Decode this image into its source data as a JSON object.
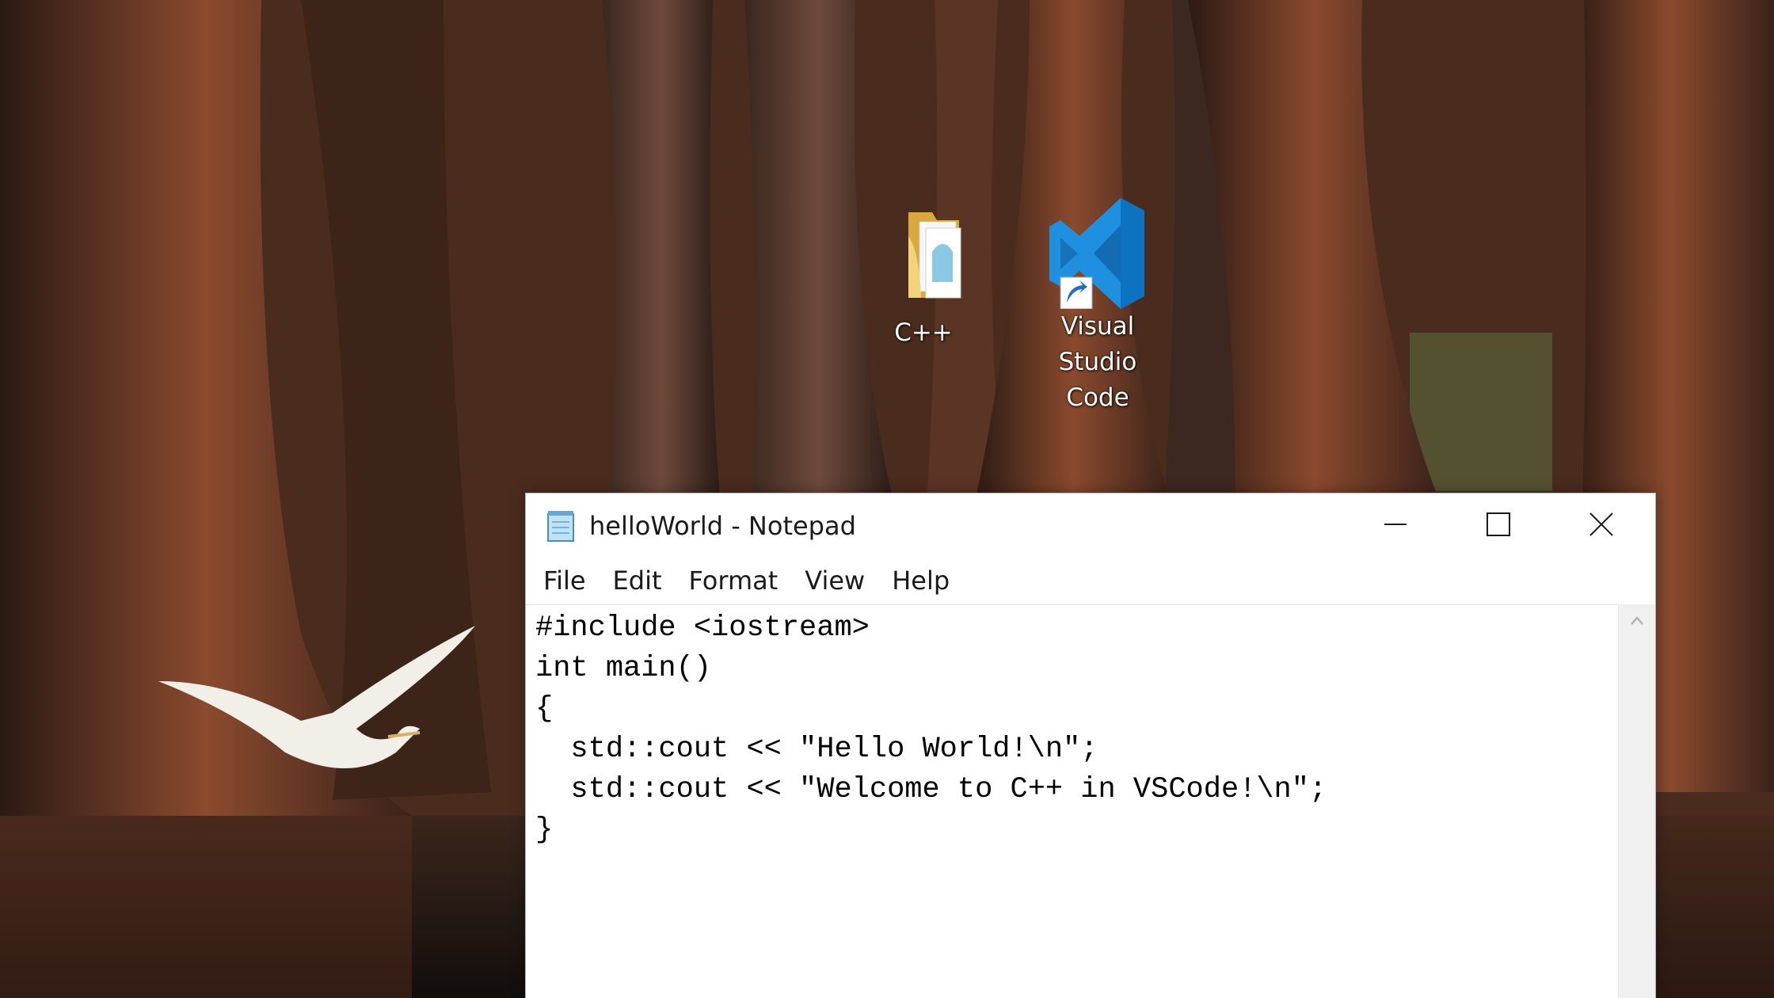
{
  "desktop": {
    "icons": [
      {
        "label": "C++",
        "icon": "folder-icon"
      },
      {
        "label": "Visual Studio\nCode",
        "icon": "vscode-icon",
        "shortcut": true
      }
    ]
  },
  "window": {
    "title": "helloWorld - Notepad",
    "app_icon": "notepad-icon",
    "controls": {
      "minimize": "minimize-icon",
      "maximize": "maximize-icon",
      "close": "close-icon"
    }
  },
  "menu": {
    "items": [
      "File",
      "Edit",
      "Format",
      "View",
      "Help"
    ]
  },
  "editor": {
    "lines": [
      "#include <iostream>",
      "int main()",
      "{",
      "  std::cout << \"Hello World!\\n\";",
      "  std::cout << \"Welcome to C++ in VSCode!\\n\";",
      "}"
    ]
  },
  "colors": {
    "vscode_blue": "#1f8fe0",
    "folder_yellow": "#f2cf6a",
    "window_bg": "#ffffff"
  }
}
